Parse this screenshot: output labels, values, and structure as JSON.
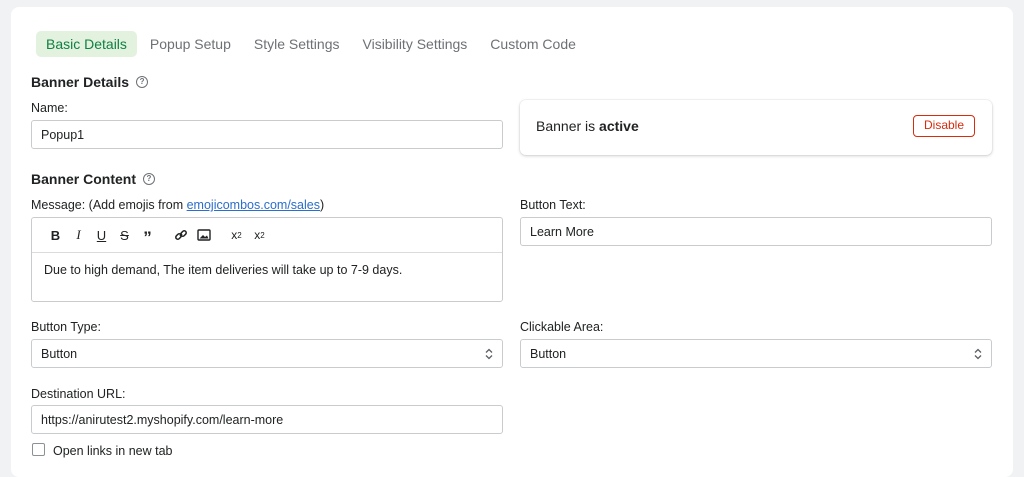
{
  "tabs": [
    {
      "label": "Basic Details",
      "active": true
    },
    {
      "label": "Popup Setup",
      "active": false
    },
    {
      "label": "Style Settings",
      "active": false
    },
    {
      "label": "Visibility Settings",
      "active": false
    },
    {
      "label": "Custom Code",
      "active": false
    }
  ],
  "banner_details": {
    "title": "Banner Details",
    "name_label": "Name:",
    "name_value": "Popup1"
  },
  "status": {
    "prefix": "Banner is ",
    "state": "active",
    "disable_label": "Disable"
  },
  "banner_content": {
    "title": "Banner Content",
    "message_label_prefix": "Message: (Add emojis from ",
    "message_link": "emojicombos.com/sales",
    "message_label_suffix": ")",
    "message_text": "Due to high demand, The item deliveries will take up to 7-9 days.",
    "button_text_label": "Button Text:",
    "button_text_value": "Learn More",
    "button_type_label": "Button Type:",
    "button_type_value": "Button",
    "clickable_area_label": "Clickable Area:",
    "clickable_area_value": "Button",
    "destination_label": "Destination URL:",
    "destination_value": "https://anirutest2.myshopify.com/learn-more",
    "new_tab_label": "Open links in new tab"
  },
  "toolbar": {
    "bold": "B",
    "italic": "I",
    "underline": "U",
    "strike": "S",
    "quote": "”",
    "subscript": "x₂",
    "superscript": "x²"
  },
  "colors": {
    "accent": "#108043",
    "danger": "#d82c0d",
    "link": "#2c6ecb"
  }
}
